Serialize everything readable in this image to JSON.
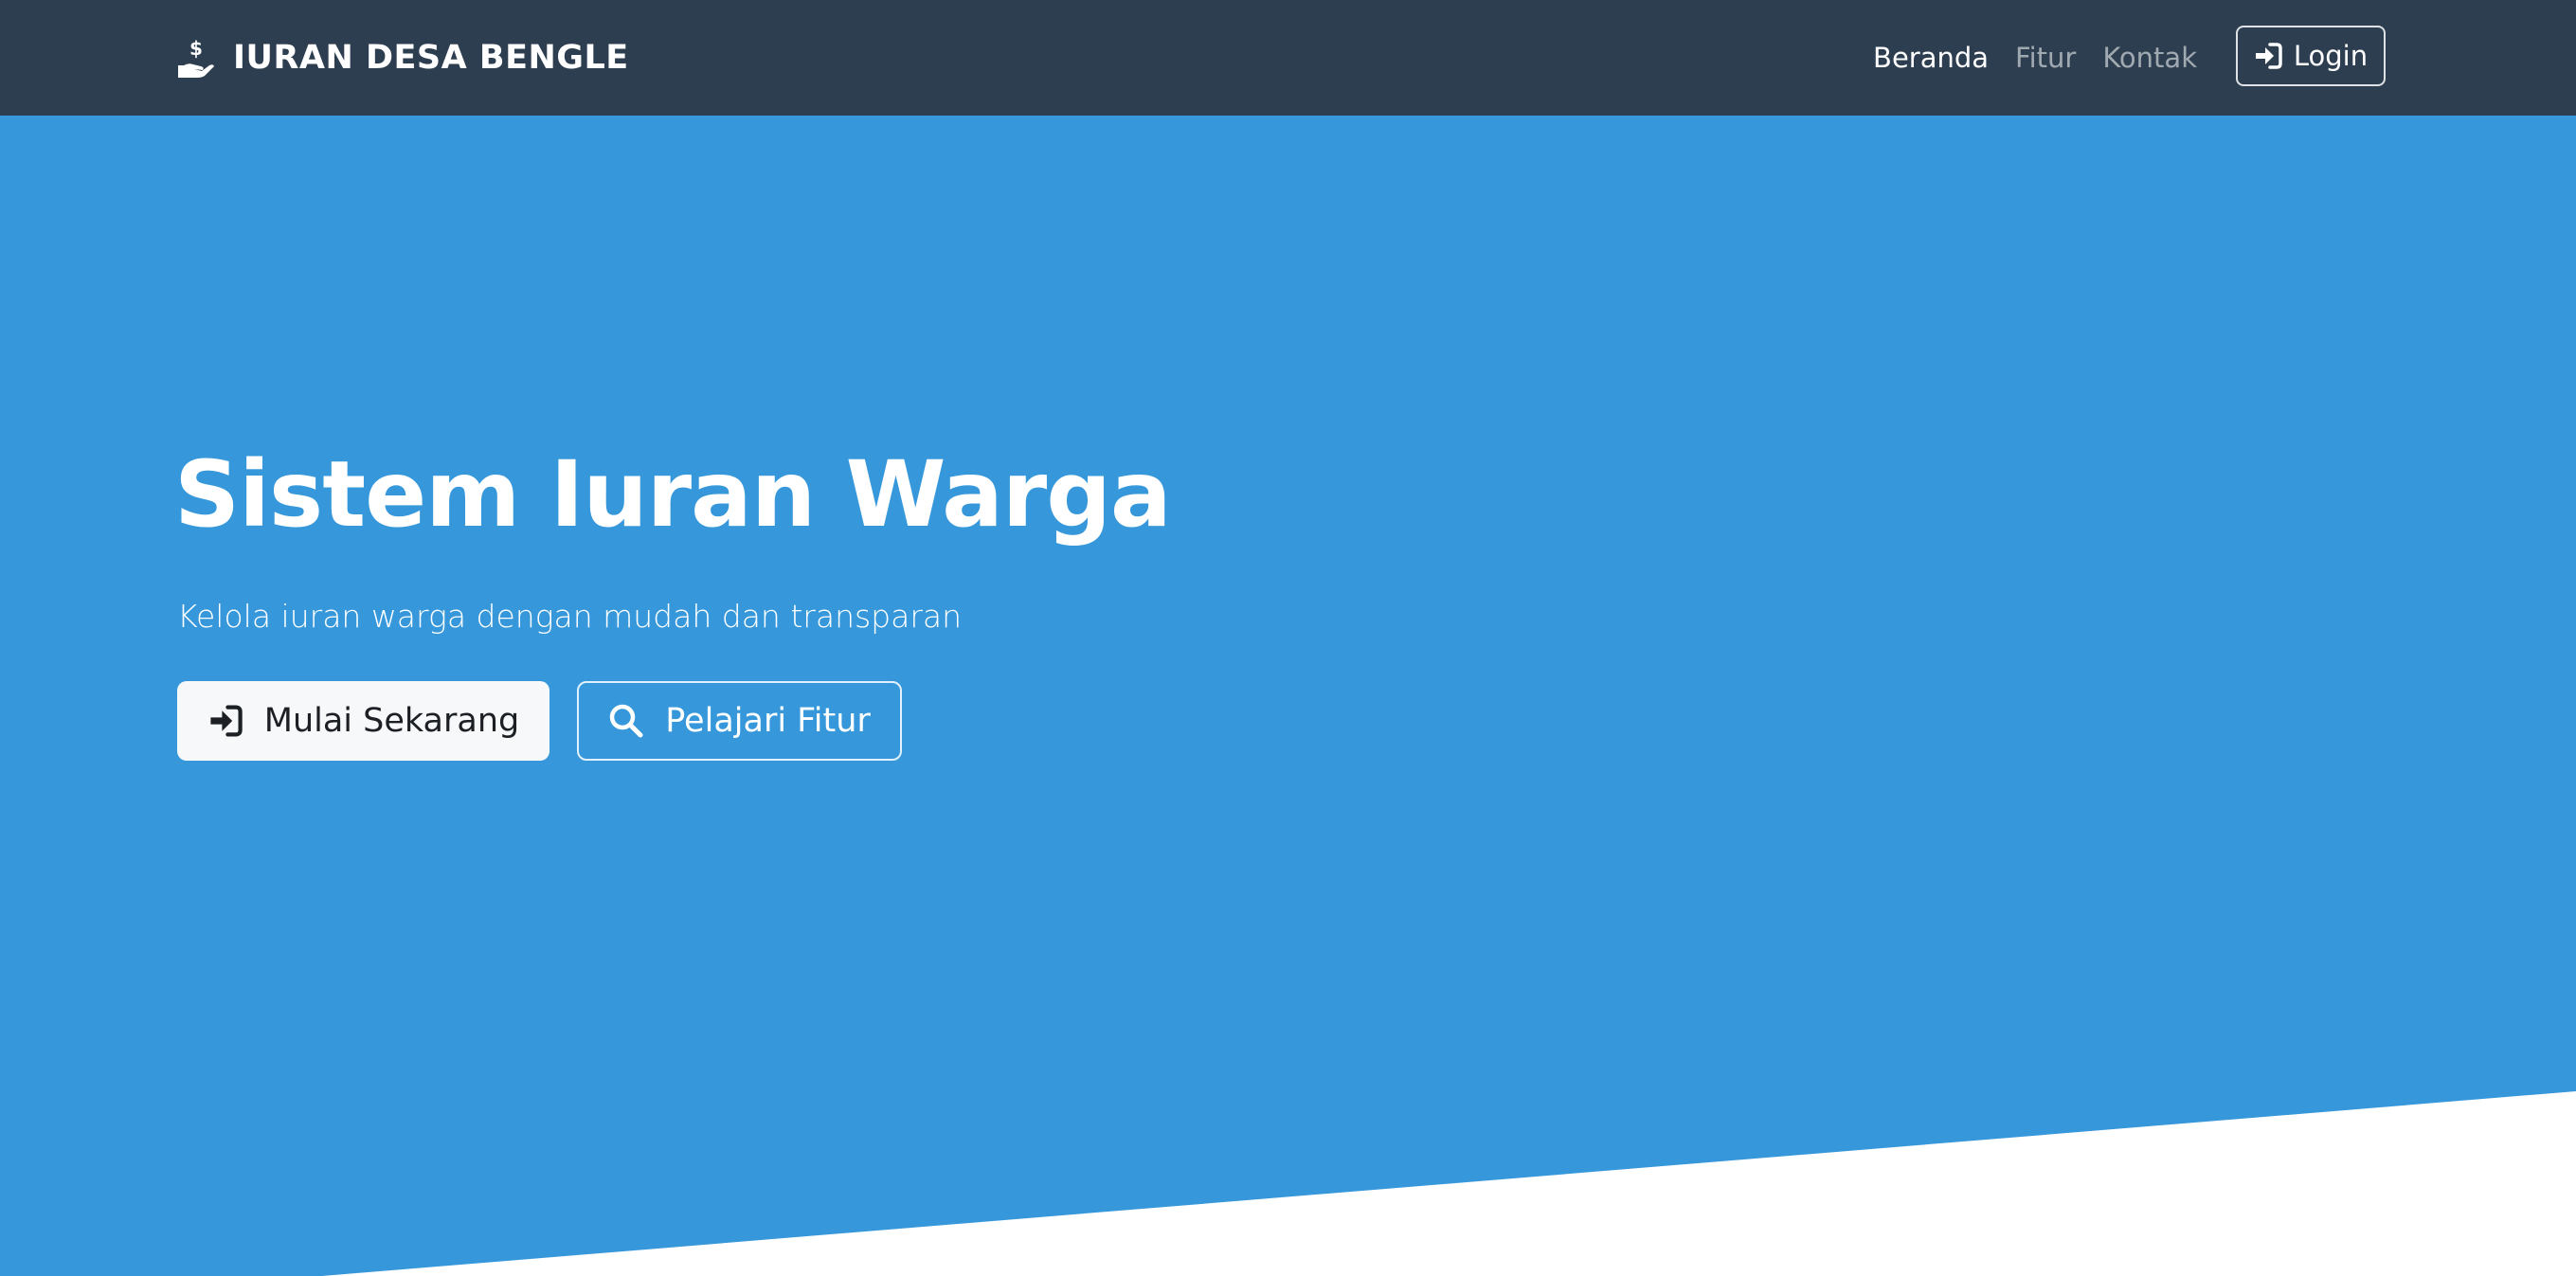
{
  "navbar": {
    "brand": "IURAN DESA BENGLE",
    "brand_icon": "hand-holding-dollar-icon",
    "links": [
      {
        "label": "Beranda",
        "active": true
      },
      {
        "label": "Fitur",
        "active": false
      },
      {
        "label": "Kontak",
        "active": false
      }
    ],
    "login_label": "Login",
    "login_icon": "sign-in-icon"
  },
  "hero": {
    "title": "Sistem Iuran Warga",
    "subtitle": "Kelola iuran warga dengan mudah dan transparan",
    "primary_button": {
      "label": "Mulai Sekarang",
      "icon": "sign-in-icon"
    },
    "secondary_button": {
      "label": "Pelajari Fitur",
      "icon": "search-icon"
    }
  },
  "colors": {
    "navbar_bg": "#2d3e51",
    "hero_bg": "#3698db",
    "primary_button_bg": "#f6f8fa",
    "wave": "#ffffff"
  }
}
